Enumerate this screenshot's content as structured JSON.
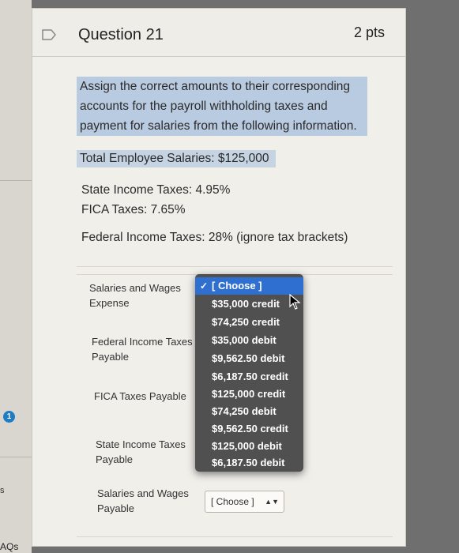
{
  "sidebar": {
    "badge": "1",
    "faqs_label": "AQs",
    "fragment": "s"
  },
  "question": {
    "title": "Question 21",
    "points": "2 pts",
    "prompt": "Assign the correct amounts to their corresponding accounts for the payroll withholding taxes and payment for salaries from the following information.",
    "total_salaries": "Total Employee Salaries: $125,000",
    "state_tax": "State Income Taxes: 4.95%",
    "fica_tax": "FICA Taxes: 7.65%",
    "federal_tax": "Federal Income Taxes: 28% (ignore tax brackets)"
  },
  "rows": [
    {
      "label_line1": "Salaries and Wages",
      "label_line2": "Expense"
    },
    {
      "label_line1": "Federal Income Taxes",
      "label_line2": "Payable"
    },
    {
      "label_line1": "FICA Taxes Payable",
      "label_line2": ""
    },
    {
      "label_line1": "State Income Taxes",
      "label_line2": "Payable"
    },
    {
      "label_line1": "Salaries and Wages",
      "label_line2": "Payable"
    }
  ],
  "dropdown": {
    "check": "✓",
    "options": [
      "[ Choose ]",
      "$35,000 credit",
      "$74,250 credit",
      "$35,000 debit",
      "$9,562.50 debit",
      "$6,187.50 credit",
      "$125,000 credit",
      "$74,250 debit",
      "$9,562.50 credit",
      "$125,000 debit",
      "$6,187.50 debit"
    ]
  },
  "closed_select": {
    "value": "[ Choose ]",
    "arrows": "▲▼"
  }
}
